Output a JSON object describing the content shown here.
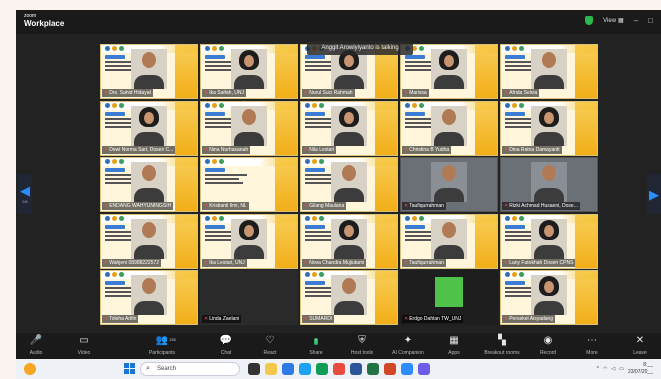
{
  "window": {
    "brand_line1": "zoom",
    "brand_line2": "Workplace",
    "view_label": "View",
    "view_icon": "grid-icon",
    "minimize_glyph": "–",
    "maximize_glyph": "□",
    "shield_color": "#2db84d"
  },
  "gallery": {
    "page_indicator_left": "2/6",
    "toast": "Anggit Arowiyiyanto is talking"
  },
  "participants": [
    {
      "name": "Drs. Sahid Hidayat",
      "type": "person"
    },
    {
      "name": "Ika Saifah, UNJ",
      "type": "hijab"
    },
    {
      "name": "Nurul Suci Rahmah",
      "type": "hijab"
    },
    {
      "name": "Marissa",
      "type": "hijab"
    },
    {
      "name": "Afrida Selvia",
      "type": "person"
    },
    {
      "name": "Dewi Norma Sari, Dosen C...",
      "type": "hijab"
    },
    {
      "name": "Nina Nurhasanah",
      "type": "person"
    },
    {
      "name": "Nila Lestari",
      "type": "hijab"
    },
    {
      "name": "Christina B Yudha",
      "type": "person"
    },
    {
      "name": "Dina Ratna Damayanti",
      "type": "hijab"
    },
    {
      "name": "ENDANG WAHYUNINGSIH",
      "type": "person"
    },
    {
      "name": "Kristianti Ilmi, NL",
      "type": "slide"
    },
    {
      "name": "Gilang Maulana",
      "type": "person"
    },
    {
      "name": "Taufiqurrahman",
      "type": "photo"
    },
    {
      "name": "Rizki Achmad Husaeni, Dose...",
      "type": "photo"
    },
    {
      "name": "Wahjeni 08988222572",
      "type": "person"
    },
    {
      "name": "Ika Lestari, UNJ",
      "type": "hijab"
    },
    {
      "name": "Nova Chandra Mujiutami",
      "type": "hijab"
    },
    {
      "name": "Taufiqurrahman",
      "type": "person"
    },
    {
      "name": "Lany Fatokhah Dosen CPNS",
      "type": "hijab"
    },
    {
      "name": "Toleha Arifin",
      "type": "person"
    },
    {
      "name": "Linda Zaelani",
      "type": "dark"
    },
    {
      "name": "SUMARDI",
      "type": "person"
    },
    {
      "name": "Erdgo Dahlan TW_UNJ",
      "type": "green"
    },
    {
      "name": "Persekel Aisyadang",
      "type": "hijab"
    }
  ],
  "toolbar": {
    "items": [
      {
        "label": "Audio",
        "icon": "microphone-icon",
        "glyph": "🎤"
      },
      {
        "label": "Video",
        "icon": "video-camera-icon",
        "glyph": "▭"
      },
      {
        "label": "Participants",
        "icon": "participants-icon",
        "glyph": "👥",
        "count": "135"
      },
      {
        "label": "Chat",
        "icon": "chat-icon",
        "glyph": "💬"
      },
      {
        "label": "React",
        "icon": "heart-icon",
        "glyph": "♡"
      },
      {
        "label": "Share",
        "icon": "share-screen-icon",
        "glyph": "↑"
      },
      {
        "label": "Host tools",
        "icon": "shield-icon",
        "glyph": "⛨"
      },
      {
        "label": "AI Companion",
        "icon": "sparkle-icon",
        "glyph": "✦"
      },
      {
        "label": "Apps",
        "icon": "apps-icon",
        "glyph": "▦"
      },
      {
        "label": "Breakout rooms",
        "icon": "breakout-rooms-icon",
        "glyph": "▚"
      },
      {
        "label": "Record",
        "icon": "record-icon",
        "glyph": "◉"
      },
      {
        "label": "More",
        "icon": "more-icon",
        "glyph": "⋯"
      },
      {
        "label": "Leave",
        "icon": "leave-icon",
        "glyph": "✕"
      }
    ]
  },
  "taskbar": {
    "search_placeholder": "Search",
    "time": "8:__",
    "date": "23/07/20__"
  }
}
